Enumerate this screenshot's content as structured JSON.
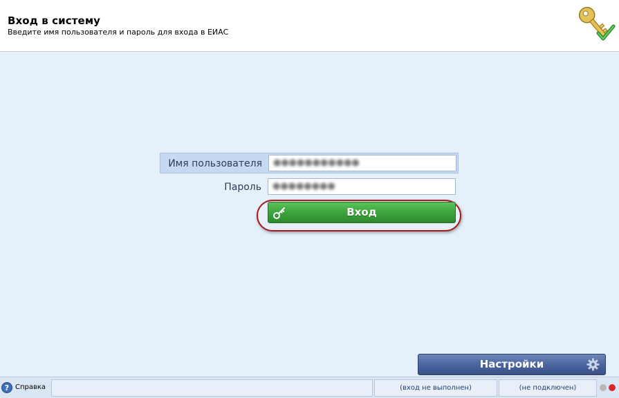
{
  "header": {
    "title": "Вход в систему",
    "subtitle": "Введите имя пользователя и пароль для входа в ЕИАС",
    "logo_icon": "key-check-icon"
  },
  "form": {
    "username_label": "Имя пользователя",
    "username_value": "●●●●●●●●●●●",
    "password_label": "Пароль",
    "password_value": "●●●●●●●●",
    "login_label": "Вход"
  },
  "settings": {
    "label": "Настройки"
  },
  "statusbar": {
    "help_label": "Справка",
    "login_status": "(вход не выполнен)",
    "connection_status": "(не подключен)"
  },
  "colors": {
    "login_green": "#3da33d",
    "settings_blue": "#4b659f",
    "highlight_ring": "#a61b1b",
    "background": "#e6f0fb",
    "status_light_off": "#b8b8b8",
    "status_light_on": "#d9262c"
  }
}
